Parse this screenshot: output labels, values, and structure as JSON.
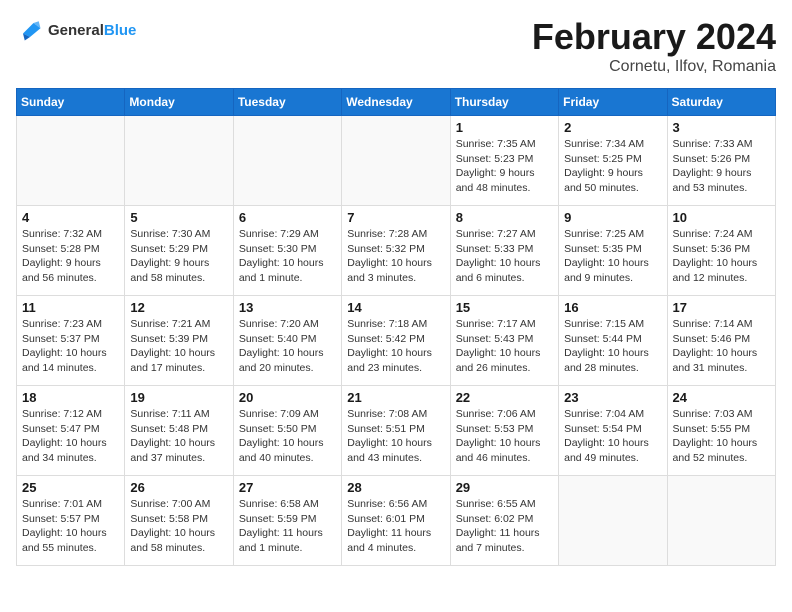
{
  "logo": {
    "text_general": "General",
    "text_blue": "Blue"
  },
  "header": {
    "month": "February 2024",
    "location": "Cornetu, Ilfov, Romania"
  },
  "weekdays": [
    "Sunday",
    "Monday",
    "Tuesday",
    "Wednesday",
    "Thursday",
    "Friday",
    "Saturday"
  ],
  "weeks": [
    [
      {
        "day": "",
        "info": ""
      },
      {
        "day": "",
        "info": ""
      },
      {
        "day": "",
        "info": ""
      },
      {
        "day": "",
        "info": ""
      },
      {
        "day": "1",
        "info": "Sunrise: 7:35 AM\nSunset: 5:23 PM\nDaylight: 9 hours\nand 48 minutes."
      },
      {
        "day": "2",
        "info": "Sunrise: 7:34 AM\nSunset: 5:25 PM\nDaylight: 9 hours\nand 50 minutes."
      },
      {
        "day": "3",
        "info": "Sunrise: 7:33 AM\nSunset: 5:26 PM\nDaylight: 9 hours\nand 53 minutes."
      }
    ],
    [
      {
        "day": "4",
        "info": "Sunrise: 7:32 AM\nSunset: 5:28 PM\nDaylight: 9 hours\nand 56 minutes."
      },
      {
        "day": "5",
        "info": "Sunrise: 7:30 AM\nSunset: 5:29 PM\nDaylight: 9 hours\nand 58 minutes."
      },
      {
        "day": "6",
        "info": "Sunrise: 7:29 AM\nSunset: 5:30 PM\nDaylight: 10 hours\nand 1 minute."
      },
      {
        "day": "7",
        "info": "Sunrise: 7:28 AM\nSunset: 5:32 PM\nDaylight: 10 hours\nand 3 minutes."
      },
      {
        "day": "8",
        "info": "Sunrise: 7:27 AM\nSunset: 5:33 PM\nDaylight: 10 hours\nand 6 minutes."
      },
      {
        "day": "9",
        "info": "Sunrise: 7:25 AM\nSunset: 5:35 PM\nDaylight: 10 hours\nand 9 minutes."
      },
      {
        "day": "10",
        "info": "Sunrise: 7:24 AM\nSunset: 5:36 PM\nDaylight: 10 hours\nand 12 minutes."
      }
    ],
    [
      {
        "day": "11",
        "info": "Sunrise: 7:23 AM\nSunset: 5:37 PM\nDaylight: 10 hours\nand 14 minutes."
      },
      {
        "day": "12",
        "info": "Sunrise: 7:21 AM\nSunset: 5:39 PM\nDaylight: 10 hours\nand 17 minutes."
      },
      {
        "day": "13",
        "info": "Sunrise: 7:20 AM\nSunset: 5:40 PM\nDaylight: 10 hours\nand 20 minutes."
      },
      {
        "day": "14",
        "info": "Sunrise: 7:18 AM\nSunset: 5:42 PM\nDaylight: 10 hours\nand 23 minutes."
      },
      {
        "day": "15",
        "info": "Sunrise: 7:17 AM\nSunset: 5:43 PM\nDaylight: 10 hours\nand 26 minutes."
      },
      {
        "day": "16",
        "info": "Sunrise: 7:15 AM\nSunset: 5:44 PM\nDaylight: 10 hours\nand 28 minutes."
      },
      {
        "day": "17",
        "info": "Sunrise: 7:14 AM\nSunset: 5:46 PM\nDaylight: 10 hours\nand 31 minutes."
      }
    ],
    [
      {
        "day": "18",
        "info": "Sunrise: 7:12 AM\nSunset: 5:47 PM\nDaylight: 10 hours\nand 34 minutes."
      },
      {
        "day": "19",
        "info": "Sunrise: 7:11 AM\nSunset: 5:48 PM\nDaylight: 10 hours\nand 37 minutes."
      },
      {
        "day": "20",
        "info": "Sunrise: 7:09 AM\nSunset: 5:50 PM\nDaylight: 10 hours\nand 40 minutes."
      },
      {
        "day": "21",
        "info": "Sunrise: 7:08 AM\nSunset: 5:51 PM\nDaylight: 10 hours\nand 43 minutes."
      },
      {
        "day": "22",
        "info": "Sunrise: 7:06 AM\nSunset: 5:53 PM\nDaylight: 10 hours\nand 46 minutes."
      },
      {
        "day": "23",
        "info": "Sunrise: 7:04 AM\nSunset: 5:54 PM\nDaylight: 10 hours\nand 49 minutes."
      },
      {
        "day": "24",
        "info": "Sunrise: 7:03 AM\nSunset: 5:55 PM\nDaylight: 10 hours\nand 52 minutes."
      }
    ],
    [
      {
        "day": "25",
        "info": "Sunrise: 7:01 AM\nSunset: 5:57 PM\nDaylight: 10 hours\nand 55 minutes."
      },
      {
        "day": "26",
        "info": "Sunrise: 7:00 AM\nSunset: 5:58 PM\nDaylight: 10 hours\nand 58 minutes."
      },
      {
        "day": "27",
        "info": "Sunrise: 6:58 AM\nSunset: 5:59 PM\nDaylight: 11 hours\nand 1 minute."
      },
      {
        "day": "28",
        "info": "Sunrise: 6:56 AM\nSunset: 6:01 PM\nDaylight: 11 hours\nand 4 minutes."
      },
      {
        "day": "29",
        "info": "Sunrise: 6:55 AM\nSunset: 6:02 PM\nDaylight: 11 hours\nand 7 minutes."
      },
      {
        "day": "",
        "info": ""
      },
      {
        "day": "",
        "info": ""
      }
    ]
  ]
}
